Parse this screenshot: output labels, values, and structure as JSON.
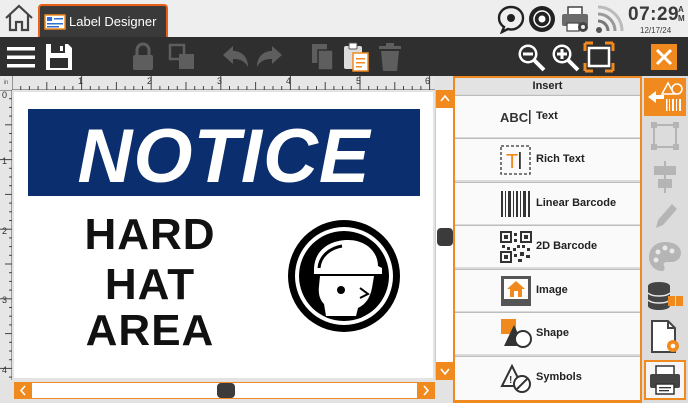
{
  "app": {
    "tab_label": "Label Designer"
  },
  "status": {
    "time": "07:29",
    "ampm_a": "A",
    "ampm_m": "M",
    "date": "12/17/24"
  },
  "ruler": {
    "top_numbers": [
      "1",
      "2",
      "3",
      "4",
      "5",
      "6"
    ],
    "left_numbers": [
      "0",
      "1",
      "2",
      "3",
      "4"
    ],
    "corner": "in"
  },
  "label": {
    "notice": "NOTICE",
    "lines": [
      "HARD",
      "HAT",
      "AREA"
    ]
  },
  "insert": {
    "header": "Insert",
    "items": [
      {
        "label": "Text",
        "icon": "text-icon"
      },
      {
        "label": "Rich Text",
        "icon": "rich-text-icon"
      },
      {
        "label": "Linear Barcode",
        "icon": "linear-barcode-icon"
      },
      {
        "label": "2D Barcode",
        "icon": "qr-code-icon"
      },
      {
        "label": "Image",
        "icon": "image-icon"
      },
      {
        "label": "Shape",
        "icon": "shape-icon"
      },
      {
        "label": "Symbols",
        "icon": "symbols-icon"
      }
    ]
  },
  "colors": {
    "accent": "#f08a1e",
    "toolbar": "#2f2f2f",
    "notice_band": "#0b2f6e"
  }
}
